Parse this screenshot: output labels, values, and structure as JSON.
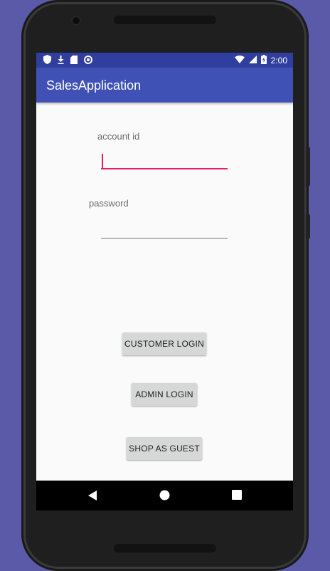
{
  "status_bar": {
    "time": "2:00",
    "left_icons": [
      "shield-icon",
      "download-icon",
      "sd-card-icon",
      "sync-icon"
    ],
    "right_icons": [
      "wifi-icon",
      "cell-signal-icon",
      "battery-charging-icon"
    ]
  },
  "app_bar": {
    "title": "SalesApplication"
  },
  "form": {
    "account_id": {
      "label": "account id",
      "value": ""
    },
    "password": {
      "label": "password",
      "value": ""
    }
  },
  "buttons": {
    "customer_login": "CUSTOMER LOGIN",
    "admin_login": "ADMIN LOGIN",
    "shop_as_guest": "SHOP AS GUEST"
  },
  "nav_bar": {
    "items": [
      "back-icon",
      "home-icon",
      "recents-icon"
    ]
  },
  "colors": {
    "primary": "#3f51b5",
    "primary_dark": "#303f9f",
    "accent": "#e91e63",
    "button_bg": "#d6d7d7"
  }
}
